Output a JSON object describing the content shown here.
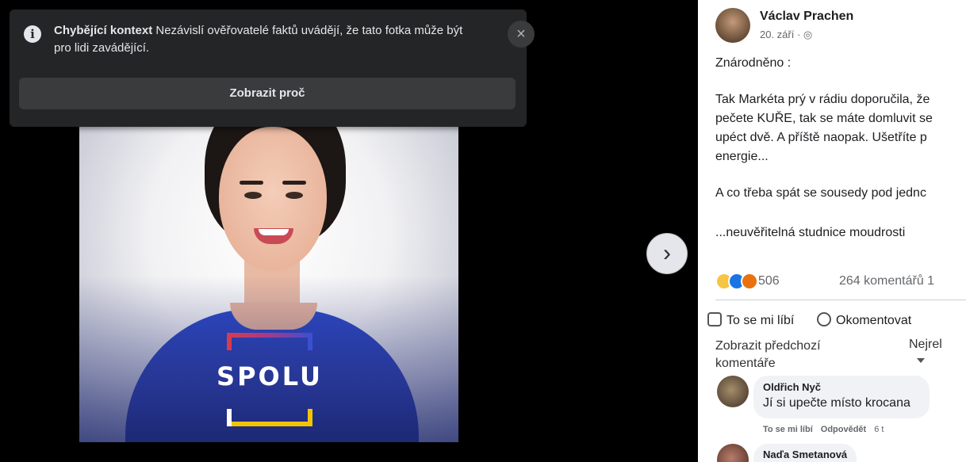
{
  "notice": {
    "title": "Chybějící kontext",
    "message": "Nezávislí ověřovatelé faktů uvádějí, že tato fotka může být pro lidi zavádějící.",
    "close_label": "×",
    "button_label": "Zobrazit proč",
    "info_icon": "i"
  },
  "photo": {
    "logo_text": "SPOLU"
  },
  "viewer": {
    "next_label": "›"
  },
  "post": {
    "author": "Václav Prachen",
    "date": "20. září · ◎",
    "lines": [
      "Znárodněno :",
      "Tak Markéta prý v rádiu doporučila, že",
      "pečete KUŘE, tak se máte domluvit se",
      "upéct dvě. A příště naopak. Ušetříte p",
      "energie...",
      "A co třeba spát se sousedy pod jednc",
      "...neuvěřitelná studnice moudrosti"
    ],
    "reaction_count": "506",
    "comments_count": "264 komentářů 1",
    "like_label": "To se mi líbí",
    "comment_label": "Okomentovat",
    "prev_comments_label": "Zobrazit předchozí komentáře",
    "sort_label": "Nejrel"
  },
  "comments": [
    {
      "name": "Oldřich Nyč",
      "text": "Jí si upečte místo krocana",
      "like_label": "To se mi líbí",
      "reply_label": "Odpovědět",
      "time": "6 t"
    },
    {
      "name": "Naďa Smetanová"
    }
  ],
  "colors": {
    "notice_bg": "#242526",
    "viewer_bg": "#000000",
    "like_blue": "#1b74e4"
  }
}
